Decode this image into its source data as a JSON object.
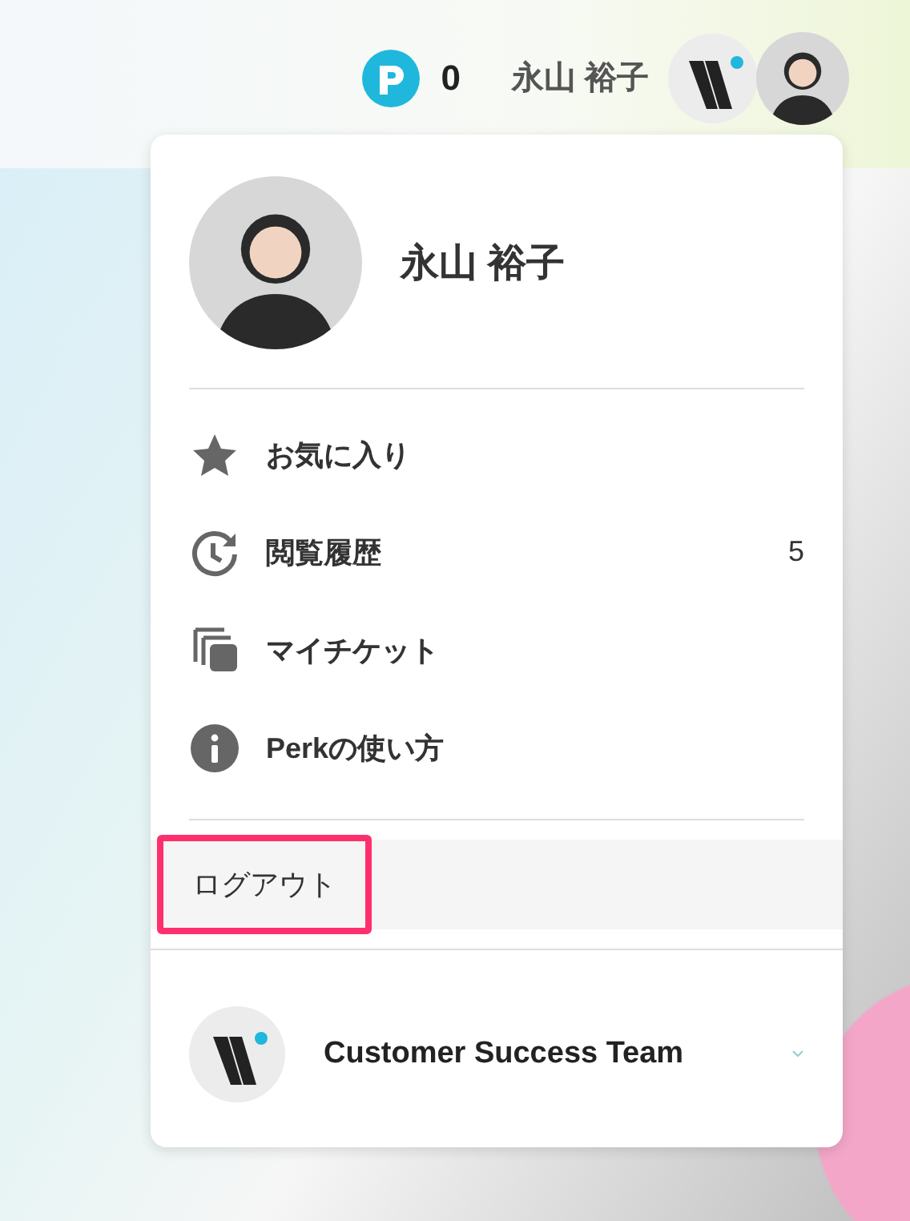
{
  "header": {
    "points": "0",
    "user_name": "永山 裕子"
  },
  "menu": {
    "user_name": "永山 裕子",
    "items": [
      {
        "kind": "star",
        "label": "お気に入り"
      },
      {
        "kind": "history",
        "label": "閲覧履歴",
        "count": "5"
      },
      {
        "kind": "tickets",
        "label": "マイチケット"
      },
      {
        "kind": "info",
        "label": "Perkの使い方"
      }
    ],
    "logout": {
      "label": "ログアウト",
      "highlighted": true
    },
    "team": {
      "name": "Customer Success Team"
    }
  }
}
